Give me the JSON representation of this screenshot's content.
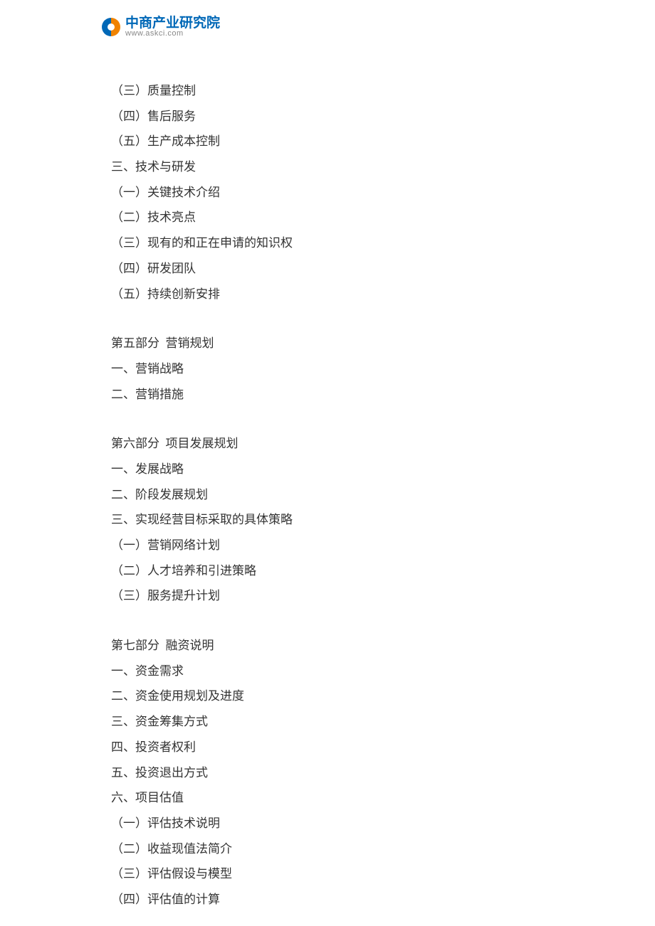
{
  "logo": {
    "title": "中商产业研究院",
    "subtitle": "www.askci.com"
  },
  "lines": [
    "（三）质量控制",
    "（四）售后服务",
    "（五）生产成本控制",
    "三、技术与研发",
    "（一）关键技术介绍",
    "（二）技术亮点",
    "（三）现有的和正在申请的知识权",
    "（四）研发团队",
    "（五）持续创新安排"
  ],
  "section5": {
    "title": "第五部分  营销规划",
    "items": [
      "一、营销战略",
      "二、营销措施"
    ]
  },
  "section6": {
    "title": "第六部分  项目发展规划",
    "items": [
      "一、发展战略",
      "二、阶段发展规划",
      "三、实现经营目标采取的具体策略",
      "（一）营销网络计划",
      "（二）人才培养和引进策略",
      "（三）服务提升计划"
    ]
  },
  "section7": {
    "title": "第七部分  融资说明",
    "items": [
      "一、资金需求",
      "二、资金使用规划及进度",
      "三、资金筹集方式",
      "四、投资者权利",
      "五、投资退出方式",
      "六、项目估值",
      "（一）评估技术说明",
      "（二）收益现值法简介",
      "（三）评估假设与模型",
      "（四）评估值的计算"
    ]
  }
}
